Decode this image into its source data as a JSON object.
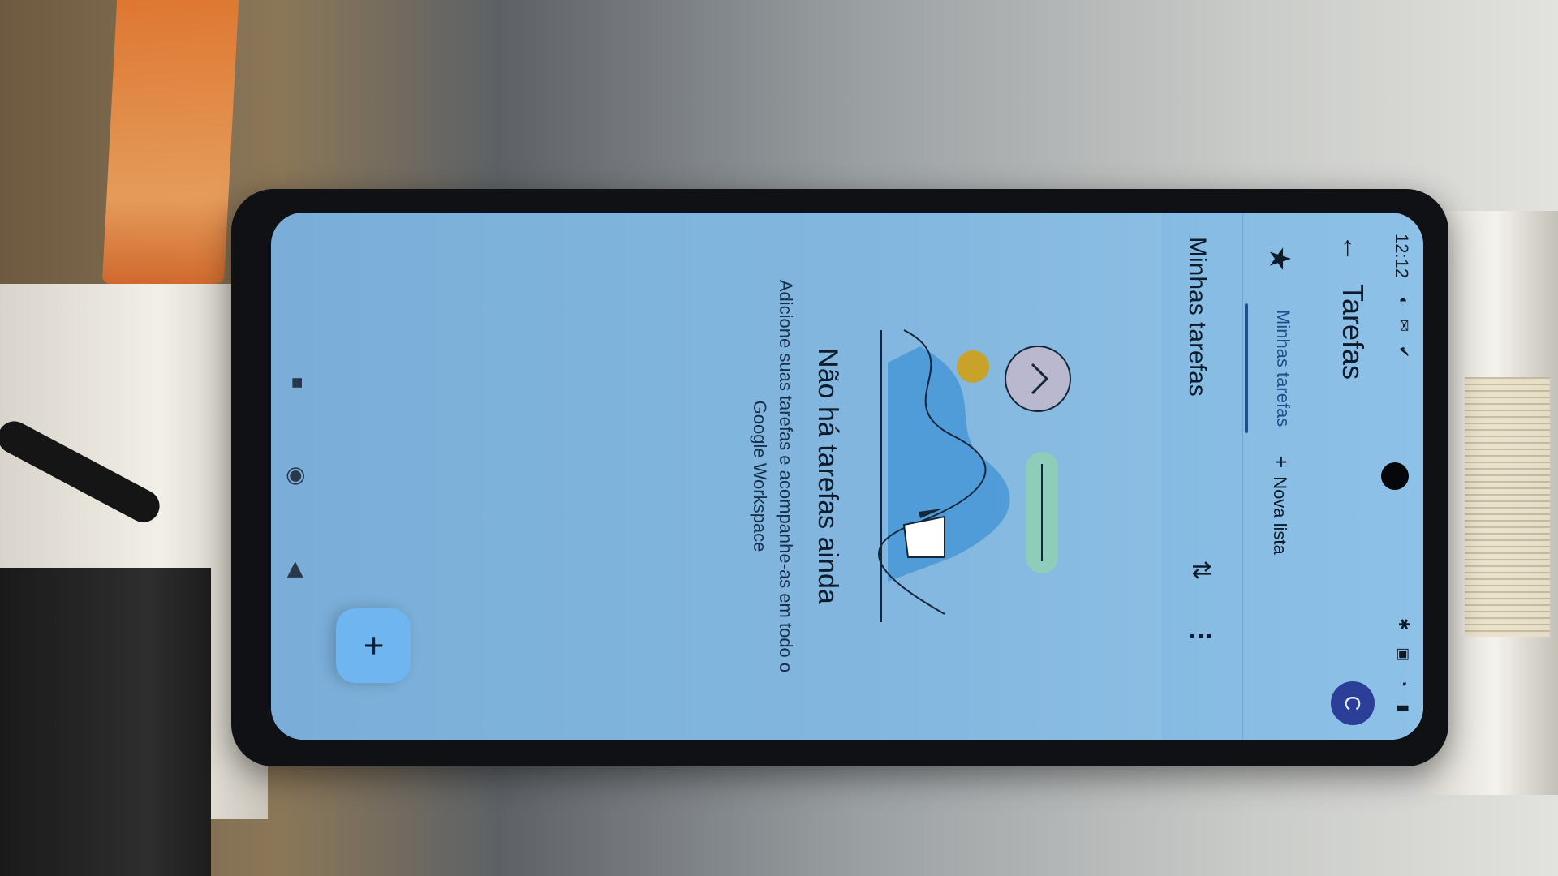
{
  "status_bar": {
    "time": "12:12",
    "left_icons": "◐ ✉ ✔",
    "right_icons": "✱ ▣ ◔ ▮"
  },
  "app_bar": {
    "back_glyph": "←",
    "title": "Tarefas",
    "avatar_letter": "C"
  },
  "tabs": {
    "starred_glyph": "★",
    "my_tasks": "Minhas tarefas",
    "new_list_plus": "+",
    "new_list": "Nova lista"
  },
  "list": {
    "title": "Minhas tarefas",
    "sort_glyph": "⇅",
    "more_glyph": "⋮"
  },
  "empty_state": {
    "title": "Não há tarefas ainda",
    "subtitle": "Adicione suas tarefas e acompanhe-as em todo o Google Workspace"
  },
  "fab": {
    "glyph": "+"
  },
  "nav_bar": {
    "back_glyph": "◀",
    "home_glyph": "◉",
    "recents_glyph": "■"
  },
  "colors": {
    "screen_bg": "#7fb4dd",
    "accent": "#1f4f8a",
    "avatar": "#2b3e98",
    "fab": "#6fb5ef",
    "illustration_yellow": "#c9a22a",
    "illustration_teal": "#4fa59a"
  }
}
